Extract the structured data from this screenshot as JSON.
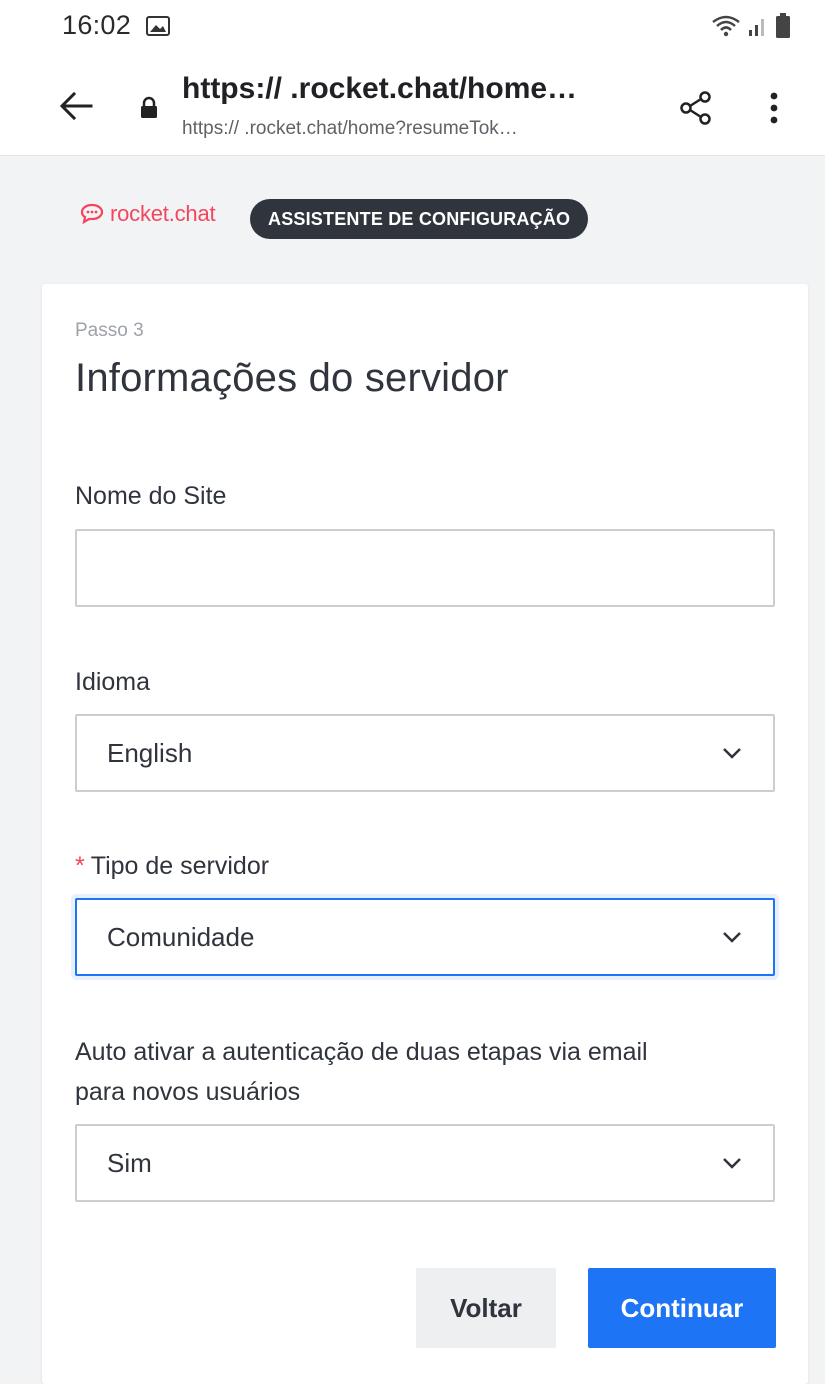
{
  "status_bar": {
    "time": "16:02",
    "icons": [
      "gallery-icon",
      "wifi-icon",
      "signal-icon",
      "battery-icon"
    ]
  },
  "browser": {
    "url_title": "https://            .rocket.chat/home…",
    "url_full": "https://             .rocket.chat/home?resumeTok…",
    "icons": [
      "back-arrow-icon",
      "lock-icon",
      "share-icon",
      "more-vert-icon"
    ]
  },
  "header": {
    "brand": "rocket.chat",
    "badge": "ASSISTENTE DE CONFIGURAÇÃO",
    "brand_color": "#f5455c",
    "badge_bg": "#2f343d"
  },
  "form": {
    "step": "Passo 3",
    "title": "Informações do servidor",
    "site_name_label": "Nome do Site",
    "site_name_value": "",
    "language_label": "Idioma",
    "language_value": "English",
    "server_type_required": "*",
    "server_type_label": "Tipo de servidor",
    "server_type_value": "Comunidade",
    "two_factor_label_line1": "Auto ativar a autenticação de duas etapas via email",
    "two_factor_label_line2": "para novos usuários",
    "two_factor_value": "Sim",
    "back_button": "Voltar",
    "continue_button": "Continuar",
    "primary_color": "#1d74f5"
  }
}
